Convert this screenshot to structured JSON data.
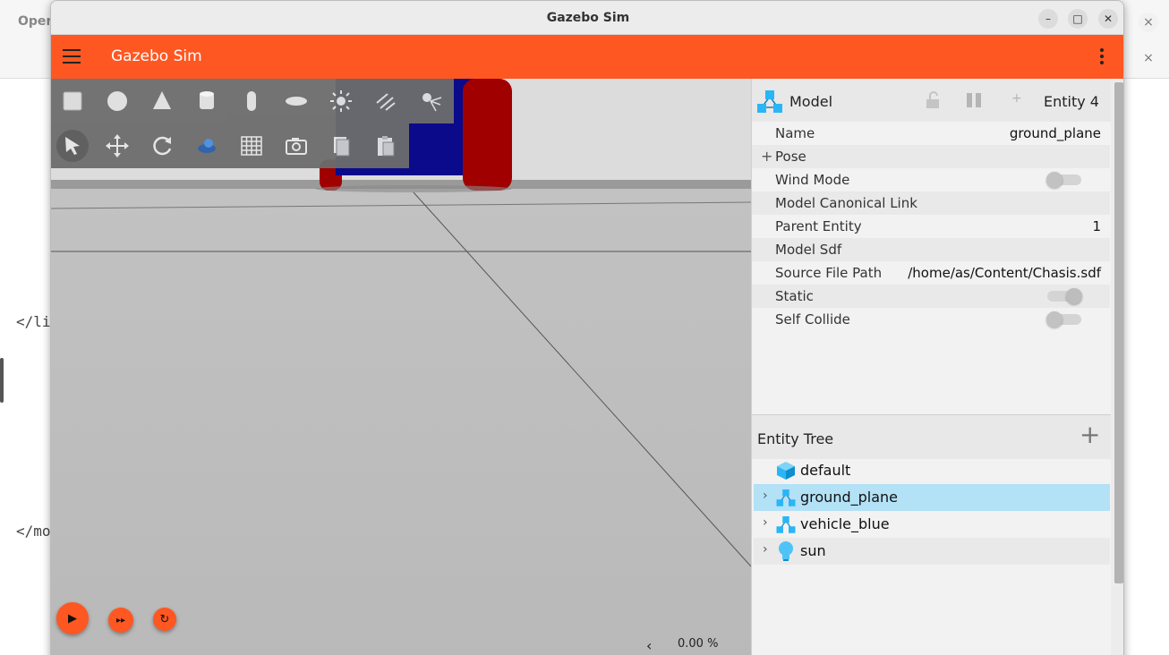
{
  "background": {
    "title": "Oper",
    "code_line_1": "</li",
    "code_line_2": "</mo",
    "close_glyph": "×"
  },
  "window": {
    "title": "Gazebo Sim",
    "min_glyph": "–",
    "max_glyph": "□",
    "close_glyph": "✕"
  },
  "appbar": {
    "title": "Gazebo Sim"
  },
  "toolbar": {
    "shapes": [
      "box-icon",
      "sphere-icon",
      "cone-icon",
      "cylinder-icon",
      "capsule-icon",
      "ellipsoid-icon",
      "point-light-icon",
      "directional-light-icon",
      "spot-light-icon"
    ],
    "tools": [
      "select-arrow-icon",
      "translate-icon",
      "rotate-icon",
      "transform-control-icon",
      "grid-icon",
      "screenshot-icon",
      "copy-icon",
      "paste-icon"
    ]
  },
  "playback": {
    "play_glyph": "▶",
    "step_glyph": "▸▸",
    "reset_glyph": "↻",
    "chevron": "‹",
    "rtf": "0.00 %"
  },
  "component_inspector": {
    "title": "Model",
    "add_glyph": "+",
    "entity": "Entity 4",
    "pose_plus": "+",
    "rows": [
      {
        "label": "Name",
        "value": "ground_plane"
      },
      {
        "label": "Pose",
        "value": ""
      },
      {
        "label": "Wind Mode",
        "toggle": false
      },
      {
        "label": "Model Canonical Link",
        "value": ""
      },
      {
        "label": "Parent Entity",
        "value": "1"
      },
      {
        "label": "Model Sdf",
        "value": ""
      },
      {
        "label": "Source File Path",
        "value": "/home/as/Content/Chasis.sdf"
      },
      {
        "label": "Static",
        "toggle": true
      },
      {
        "label": "Self Collide",
        "toggle": false
      }
    ]
  },
  "entity_tree": {
    "title": "Entity Tree",
    "add_glyph": "+",
    "items": [
      {
        "label": "default",
        "expandable": false,
        "selected": false,
        "icon": "world-cube-icon"
      },
      {
        "label": "ground_plane",
        "expandable": true,
        "selected": true,
        "icon": "model-icon"
      },
      {
        "label": "vehicle_blue",
        "expandable": true,
        "selected": false,
        "icon": "model-icon"
      },
      {
        "label": "sun",
        "expandable": true,
        "selected": false,
        "icon": "light-bulb-icon"
      }
    ],
    "chevron": "›"
  },
  "colors": {
    "accent": "#fe5722",
    "selection": "#b3e1f5",
    "icon_blue": "#29b6f6",
    "vehicle_body": "#0a0a8a",
    "vehicle_wheel": "#a00000"
  }
}
